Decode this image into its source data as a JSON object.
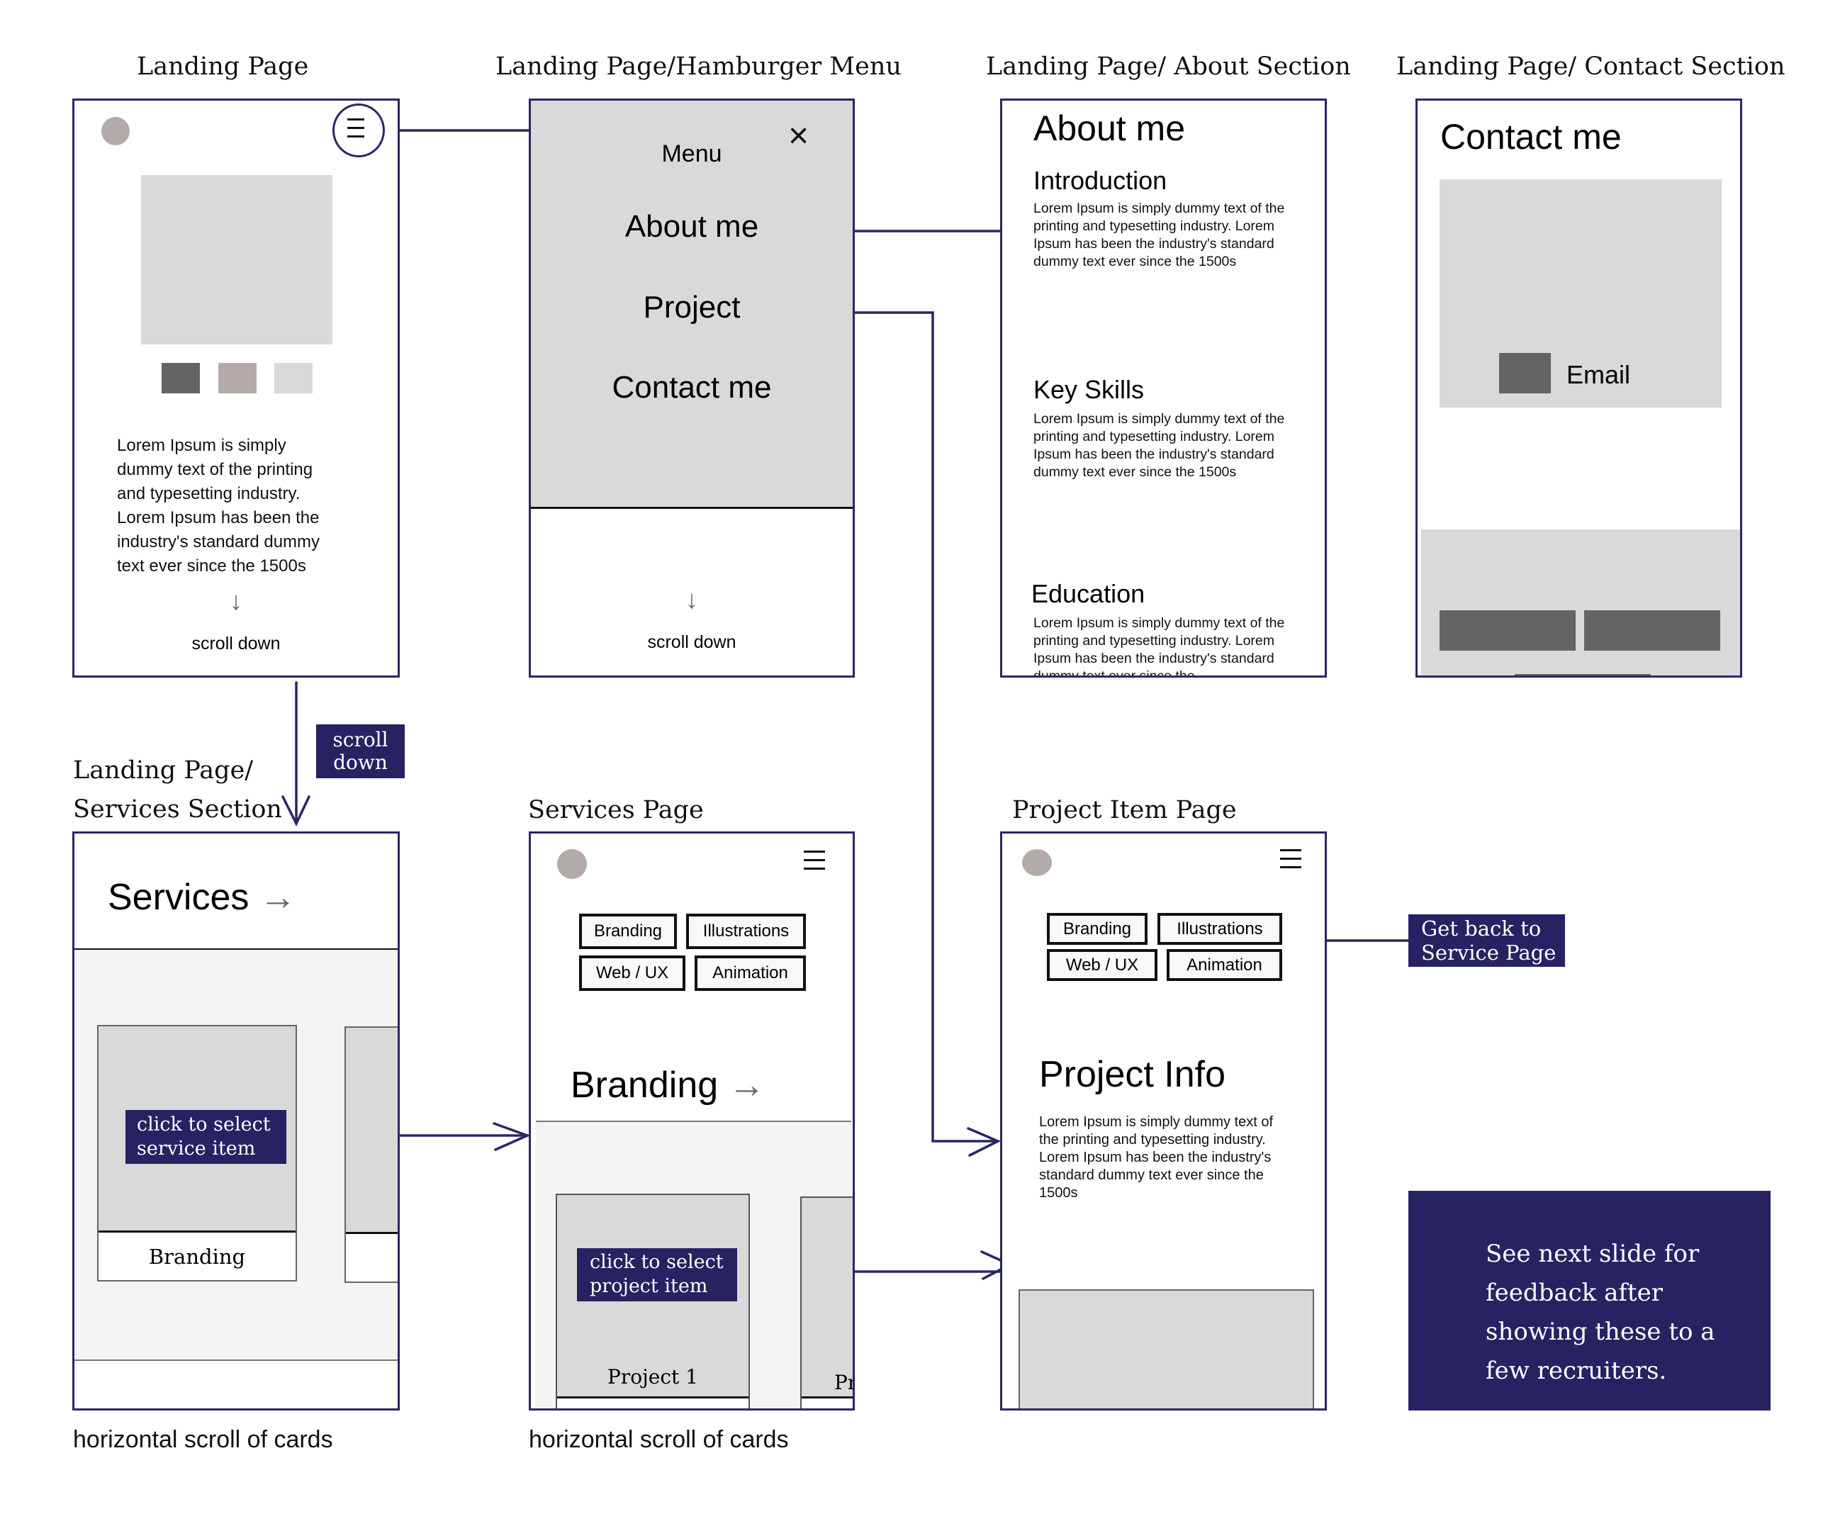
{
  "colors": {
    "accent": "#272262",
    "frame_border": "#2a2765",
    "placeholder_grey": "#d9d9d9",
    "dark_grey": "#646464",
    "avatar_grey": "#b3aaaa",
    "light_panel": "#f4f4f4"
  },
  "frames": {
    "landing": {
      "title": "Landing Page",
      "body": "Lorem Ipsum is simply dummy text of the printing and typesetting industry. Lorem Ipsum has been the industry's standard dummy text ever since the 1500s",
      "scroll_arrow": "↓",
      "scroll_label": "scroll down"
    },
    "hamburger": {
      "title": "Landing Page/Hamburger Menu",
      "menu_label": "Menu",
      "close_glyph": "×",
      "items": [
        "About me",
        "Project",
        "Contact me"
      ],
      "scroll_arrow": "↓",
      "scroll_label": "scroll down"
    },
    "about": {
      "title": "Landing Page/ About Section",
      "heading": "About me",
      "sections": [
        {
          "heading": "Introduction",
          "body": "Lorem Ipsum is simply dummy text of the printing and typesetting industry. Lorem Ipsum has been the industry's standard dummy text ever since the 1500s"
        },
        {
          "heading": "Key Skills",
          "body": "Lorem Ipsum is simply dummy text of the printing and typesetting industry. Lorem Ipsum has been the industry's standard dummy text ever since the 1500s"
        },
        {
          "heading": "Education",
          "body": "Lorem Ipsum is simply dummy text of the printing and typesetting industry. Lorem Ipsum has been the industry's standard dummy text ever since the"
        }
      ]
    },
    "contact": {
      "title": "Landing Page/ Contact Section",
      "heading": "Contact me",
      "email_label": "Email"
    },
    "services_section": {
      "title_line1": "Landing Page/",
      "title_line2": "Services Section",
      "heading": "Services",
      "arrow": "→",
      "card_label": "Branding",
      "caption": "horizontal scroll of  cards"
    },
    "services_page": {
      "title": "Services Page",
      "chips": [
        "Branding",
        "Illustrations",
        "Web / UX",
        "Animation"
      ],
      "heading": "Branding",
      "arrow": "→",
      "card_label": "Project 1",
      "card_label_partial": "Pr",
      "caption": "horizontal scroll of  cards"
    },
    "project_item": {
      "title": "Project Item Page",
      "chips": [
        "Branding",
        "Illustrations",
        "Web / UX",
        "Animation"
      ],
      "heading": "Project Info",
      "body": "Lorem Ipsum is simply dummy text of the printing and typesetting industry. Lorem Ipsum has been the industry's standard dummy text ever since the 1500s"
    }
  },
  "annotations": {
    "scroll_down": "scroll down",
    "select_service": "click to select service item",
    "select_project": "click to select project item",
    "get_back": "Get back to Service Page",
    "next_slide": "See next slide for feedback after showing these to a few recruiters."
  }
}
